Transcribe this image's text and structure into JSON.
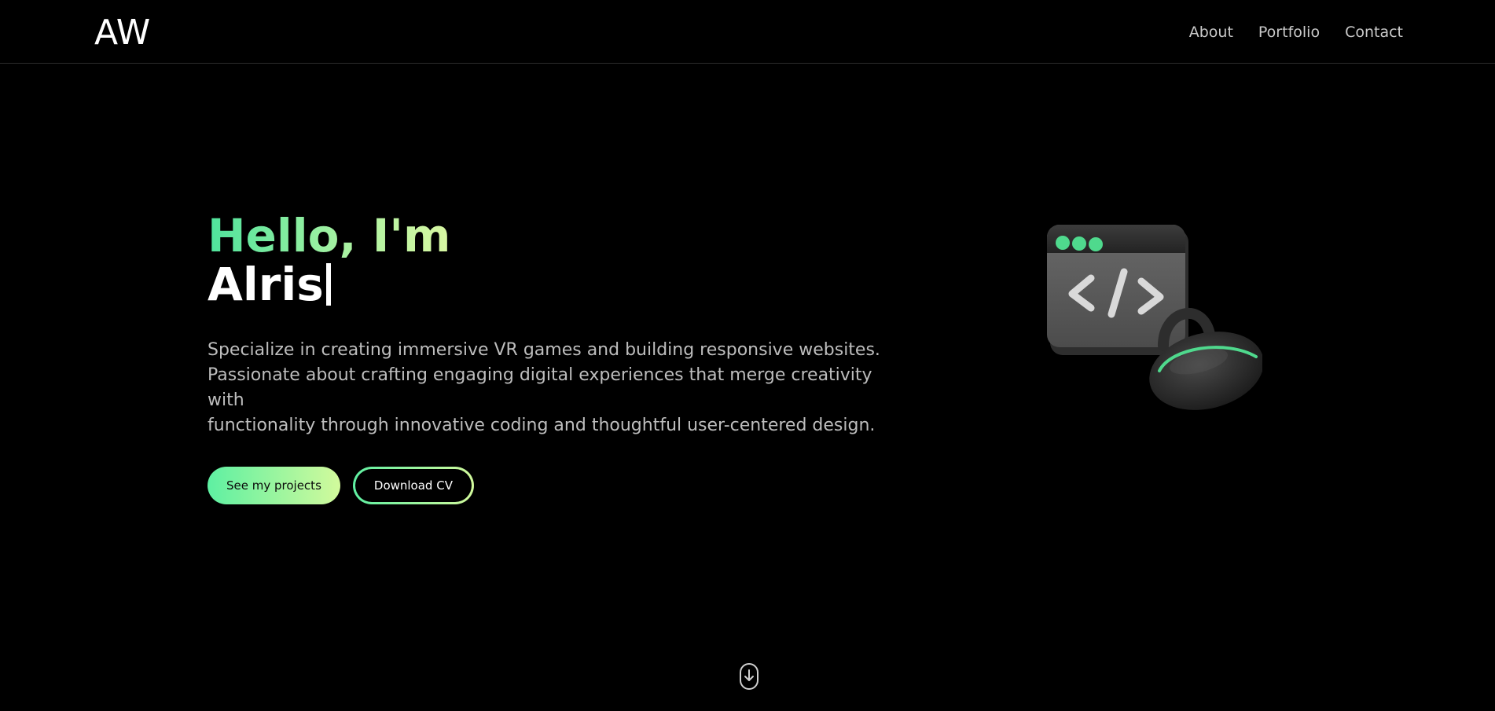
{
  "logo": {
    "text": "AW"
  },
  "nav": {
    "items": [
      {
        "label": "About"
      },
      {
        "label": "Portfolio"
      },
      {
        "label": "Contact"
      }
    ]
  },
  "hero": {
    "greeting": "Hello, I'm",
    "name": "Alris",
    "description": [
      "Specialize in creating immersive VR games and building responsive websites.",
      "Passionate about crafting engaging digital experiences that merge creativity with",
      "functionality through innovative coding and thoughtful user-centered design."
    ],
    "primary_button": "See my projects",
    "secondary_button": "Download CV",
    "code_symbol": "</>"
  },
  "colors": {
    "background": "#000000",
    "accent_start": "#4ee39c",
    "accent_end": "#d8f7a2",
    "text_muted": "#bdbdbd"
  },
  "icons": {
    "scroll": "mouse-scroll-icon",
    "illustration": "code-window-vr-headset-illustration"
  }
}
